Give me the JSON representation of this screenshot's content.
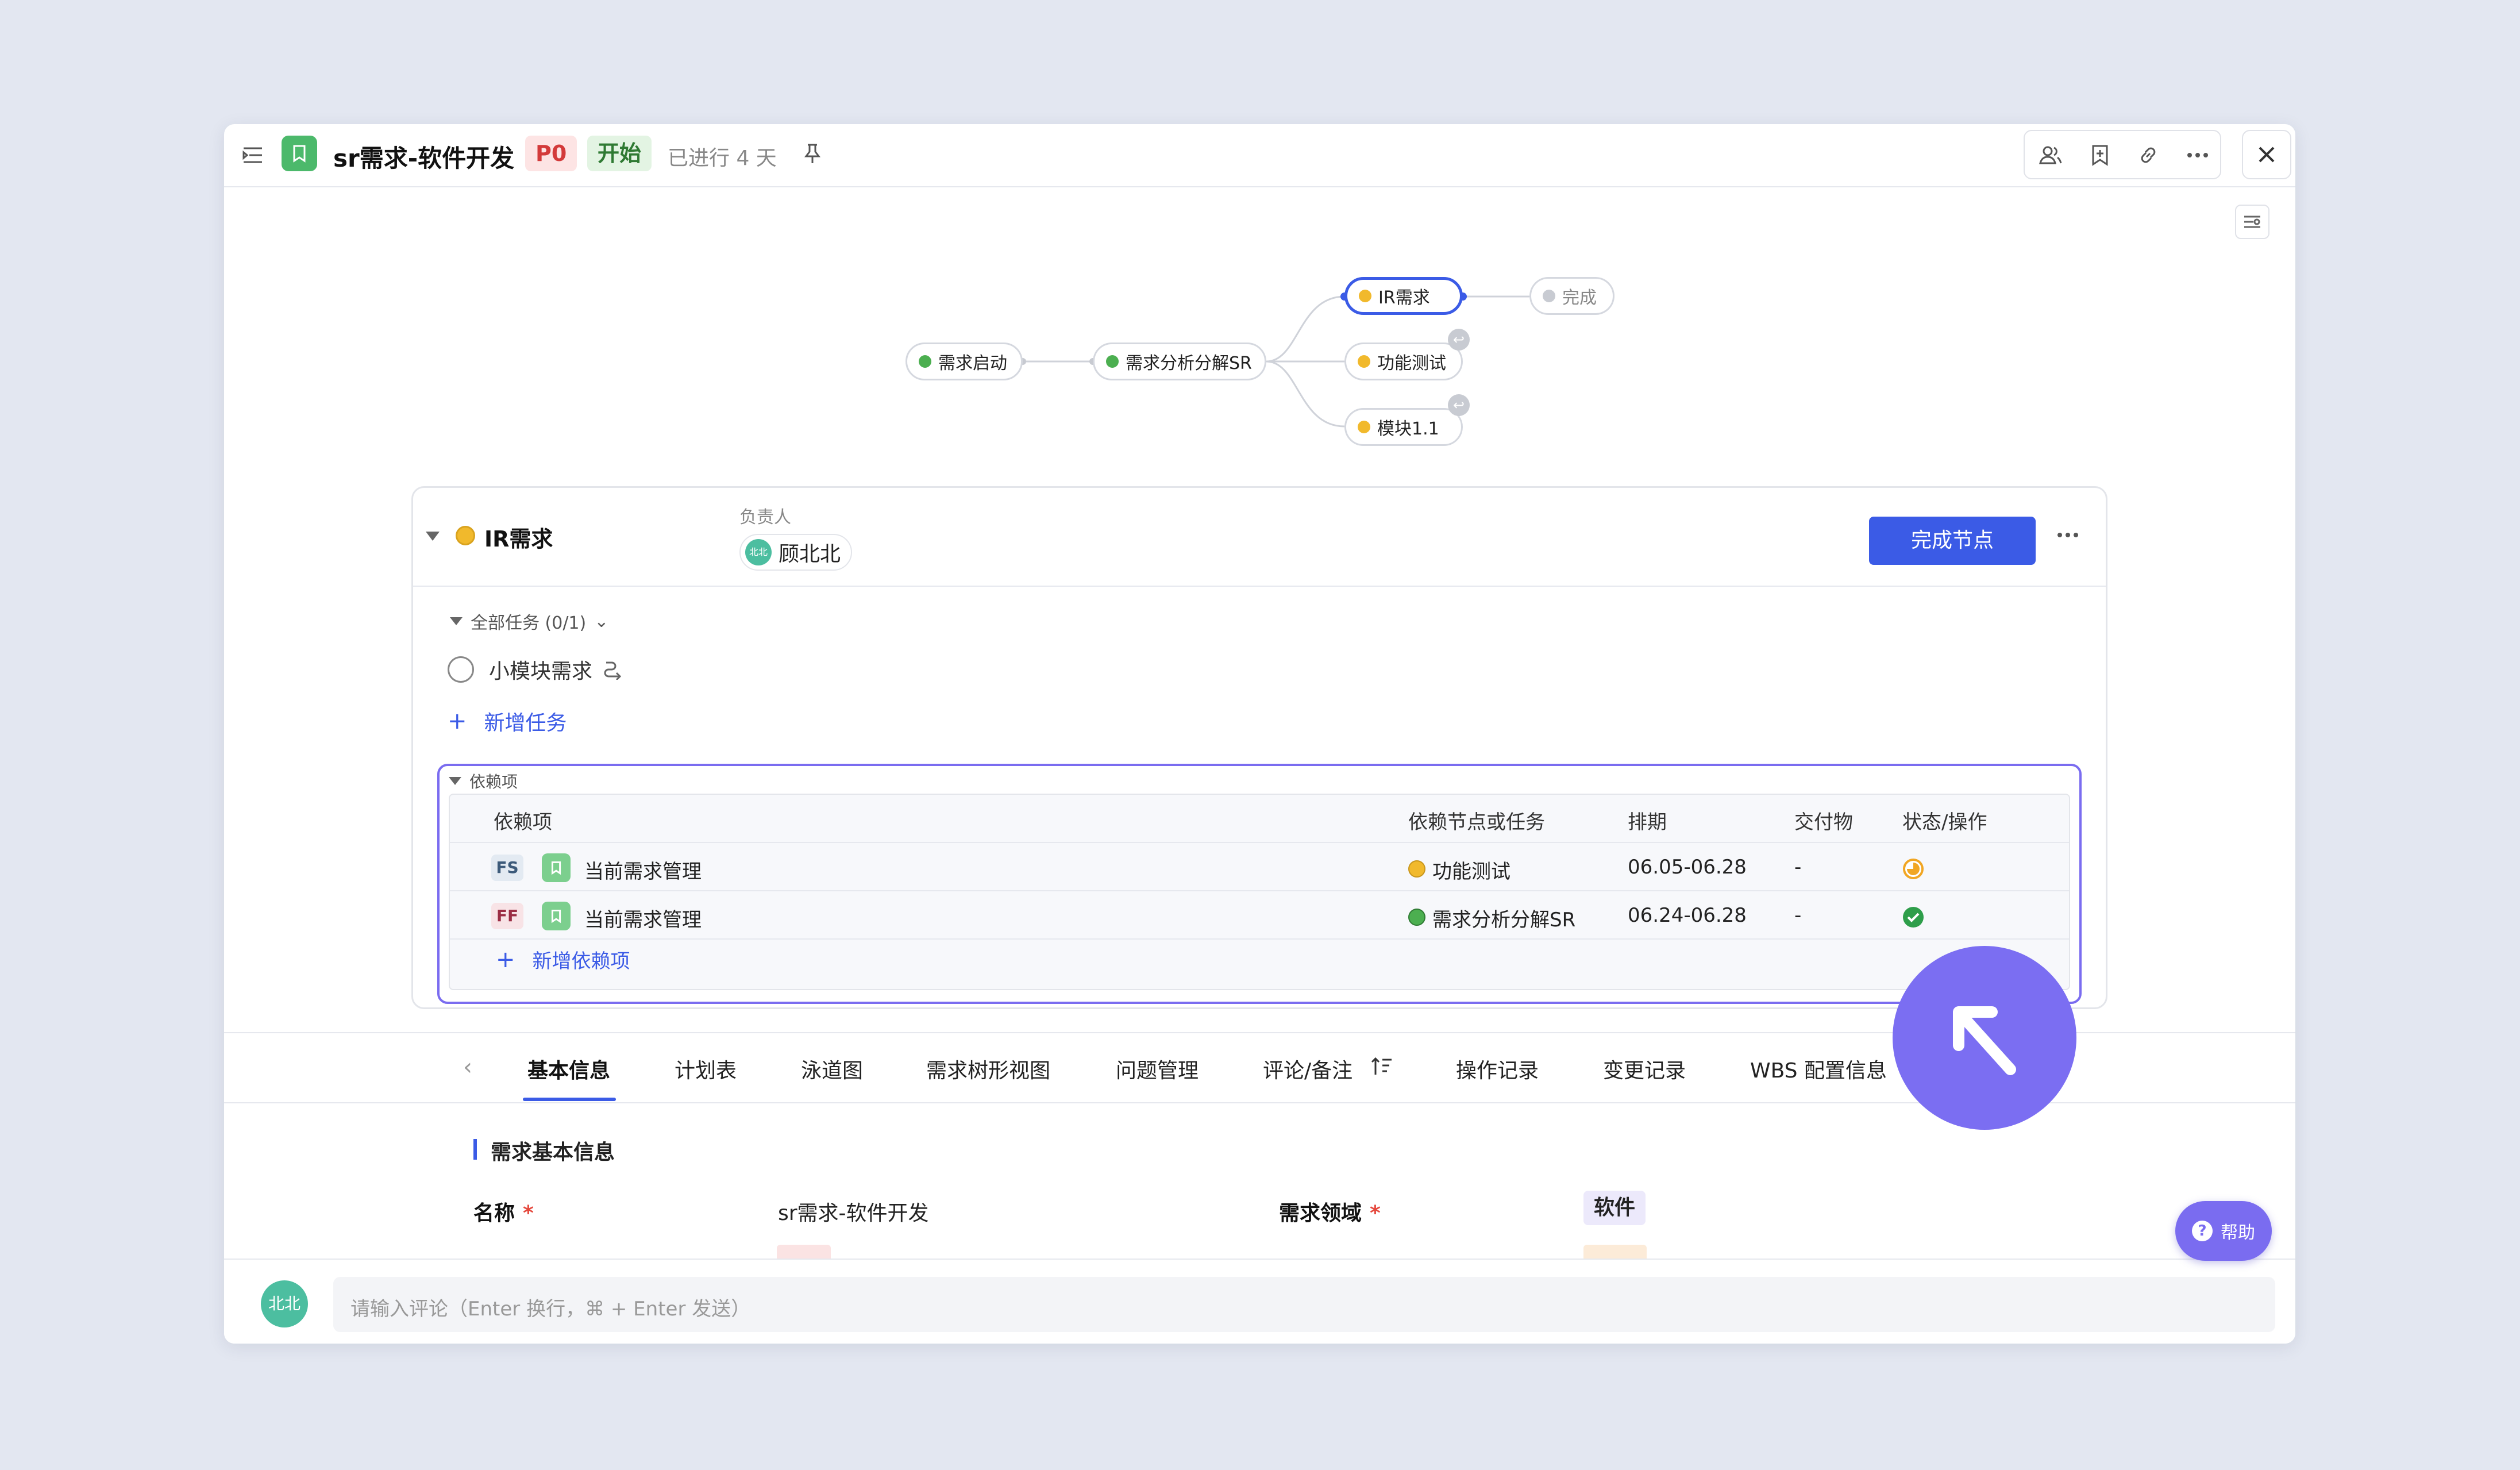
{
  "header": {
    "title": "sr需求-软件开发",
    "priority": "P0",
    "status": "开始",
    "elapsed": "已进行 4 天"
  },
  "flow": {
    "nodes": [
      {
        "label": "需求启动",
        "color": "#4caf50"
      },
      {
        "label": "需求分析分解SR",
        "color": "#4caf50"
      },
      {
        "label": "IR需求",
        "color": "#f1b92c"
      },
      {
        "label": "功能测试",
        "color": "#f1b92c"
      },
      {
        "label": "模块1.1",
        "color": "#f1b92c"
      },
      {
        "label": "完成",
        "color": "#c8cbd2"
      }
    ]
  },
  "node_panel": {
    "title": "IR需求",
    "owner_label": "负责人",
    "owner_avatar": "北北",
    "owner_name": "顾北北",
    "complete_button": "完成节点",
    "tasks_header": "全部任务 (0/1)",
    "task": "小模块需求",
    "add_task": "新增任务"
  },
  "dependencies": {
    "section_title": "依赖项",
    "columns": [
      "依赖项",
      "依赖节点或任务",
      "排期",
      "交付物",
      "状态/操作"
    ],
    "rows": [
      {
        "type": "FS",
        "name": "当前需求管理",
        "node": "功能测试",
        "node_color": "#f1b92c",
        "schedule": "06.05-06.28",
        "deliverable": "-",
        "status": "in-progress"
      },
      {
        "type": "FF",
        "name": "当前需求管理",
        "node": "需求分析分解SR",
        "node_color": "#4caf50",
        "schedule": "06.24-06.28",
        "deliverable": "-",
        "status": "done"
      }
    ],
    "add_label": "新增依赖项"
  },
  "tabs": [
    "基本信息",
    "计划表",
    "泳道图",
    "需求树形视图",
    "问题管理",
    "评论/备注",
    "操作记录",
    "变更记录",
    "WBS 配置信息"
  ],
  "basic_info": {
    "section_title": "需求基本信息",
    "name_label": "名称",
    "name_value": "sr需求-软件开发",
    "domain_label": "需求领域",
    "domain_value": "软件"
  },
  "help_label": "帮助",
  "comment": {
    "avatar": "北北",
    "placeholder": "请输入评论（Enter 换行，⌘ + Enter 发送）"
  },
  "colors": {
    "accent": "#3b5be6",
    "purple": "#7a6cf0",
    "green_icon": "#4cb96b"
  }
}
